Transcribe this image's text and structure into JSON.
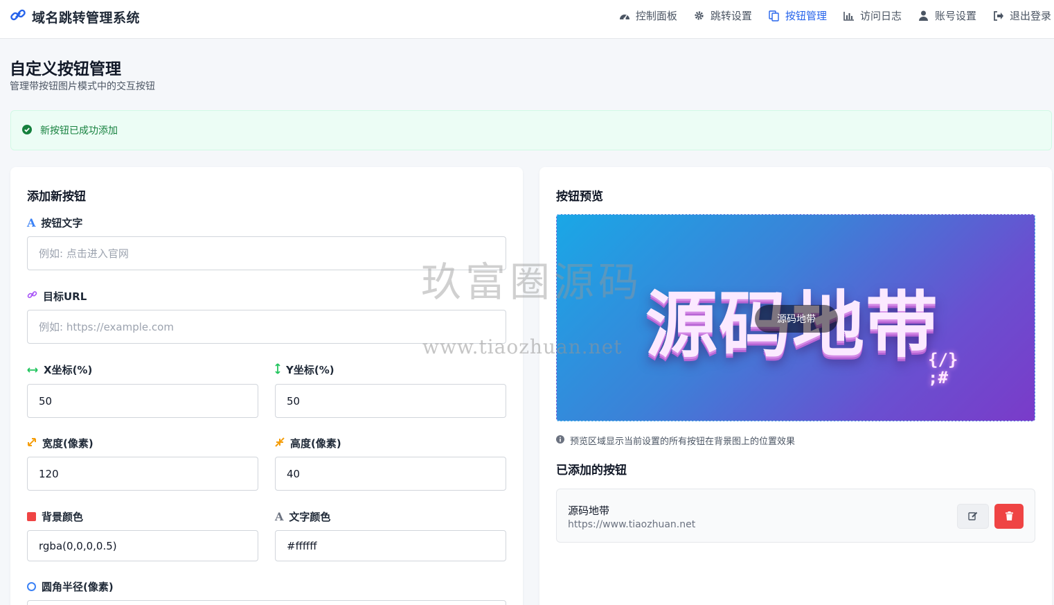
{
  "app": {
    "title": "域名跳转管理系统"
  },
  "nav": [
    {
      "label": "控制面板",
      "icon": "dashboard-icon"
    },
    {
      "label": "跳转设置",
      "icon": "gear-icon"
    },
    {
      "label": "按钮管理",
      "icon": "copy-icon",
      "active": true
    },
    {
      "label": "访问日志",
      "icon": "bar-chart-icon"
    },
    {
      "label": "账号设置",
      "icon": "user-icon"
    },
    {
      "label": "退出登录",
      "icon": "sign-out-icon"
    }
  ],
  "page": {
    "title": "自定义按钮管理",
    "subtitle": "管理带按钮图片模式中的交互按钮"
  },
  "alert": {
    "text": "新按钮已成功添加",
    "color": "#15803d"
  },
  "form": {
    "title": "添加新按钮",
    "text_label": "按钮文字",
    "text_placeholder": "例如: 点击进入官网",
    "url_label": "目标URL",
    "url_placeholder": "例如: https://example.com",
    "x_label": "X坐标(%)",
    "x_value": "50",
    "y_label": "Y坐标(%)",
    "y_value": "50",
    "width_label": "宽度(像素)",
    "width_value": "120",
    "height_label": "高度(像素)",
    "height_value": "40",
    "bg_label": "背景颜色",
    "bg_value": "rgba(0,0,0,0.5)",
    "color_label": "文字颜色",
    "color_value": "#ffffff",
    "radius_label": "圆角半径(像素)"
  },
  "preview": {
    "title": "按钮预览",
    "image_text": "源码地带",
    "image_code_line1": "{/}",
    "image_code_line2": ";#",
    "overlay_button": "源码地带",
    "note": "预览区域显示当前设置的所有按钮在背景图上的位置效果"
  },
  "added": {
    "title": "已添加的按钮",
    "items": [
      {
        "name": "源码地带",
        "url": "https://www.tiaozhuan.net"
      }
    ]
  },
  "watermark": {
    "line1": "玖富圈源码",
    "line2": "www.tiaozhuan.net"
  },
  "colors": {
    "accent": "#2563eb",
    "success_bg": "#ecfdf5",
    "danger": "#ef4444"
  }
}
